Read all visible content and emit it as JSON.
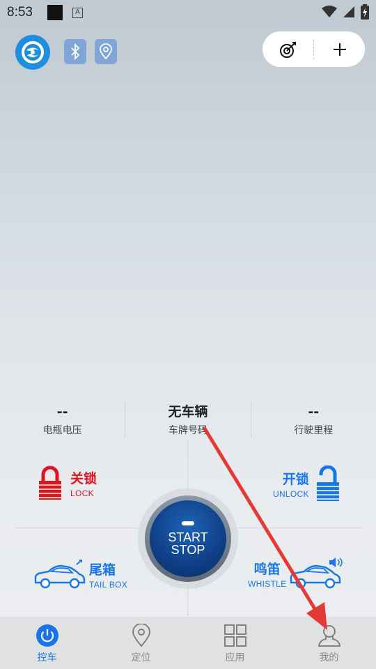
{
  "status_bar": {
    "time": "8:53",
    "indicator_letter": "A"
  },
  "info": {
    "battery_voltage": {
      "value": "--",
      "label": "电瓶电压"
    },
    "plate": {
      "value": "无车辆",
      "label": "车牌号码"
    },
    "mileage": {
      "value": "--",
      "label": "行驶里程"
    }
  },
  "controls": {
    "lock": {
      "cn": "关锁",
      "en": "LOCK"
    },
    "unlock": {
      "cn": "开锁",
      "en": "UNLOCK"
    },
    "tail_box": {
      "cn": "尾箱",
      "en": "TAIL BOX"
    },
    "whistle": {
      "cn": "鸣笛",
      "en": "WHISTLE"
    },
    "start": {
      "line1": "START",
      "line2": "STOP"
    }
  },
  "nav": [
    {
      "label": "控车",
      "icon": "power-icon",
      "active": true
    },
    {
      "label": "定位",
      "icon": "location-pin-icon",
      "active": false
    },
    {
      "label": "应用",
      "icon": "grid-icon",
      "active": false
    },
    {
      "label": "我的",
      "icon": "user-icon",
      "active": false
    }
  ],
  "colors": {
    "accent_blue": "#1877e8",
    "lock_red": "#e0141e",
    "start_blue": "#0f3f85",
    "annotation_arrow": "#e53935"
  }
}
